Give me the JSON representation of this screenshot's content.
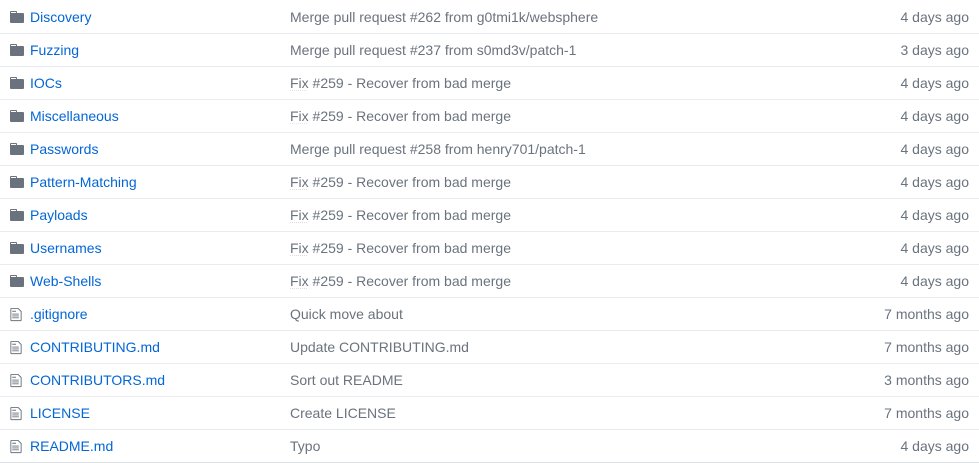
{
  "colors": {
    "link": "#0366d6",
    "muted": "#6a737d",
    "folder_icon": "#79b8ff",
    "file_icon": "#6a737d",
    "border": "#eaecef"
  },
  "rows": [
    {
      "type": "directory",
      "icon": "folder-icon",
      "name": "Discovery",
      "message_prefix": "",
      "message": "Merge pull request #262 from g0tmi1k/websphere",
      "age": "4 days ago"
    },
    {
      "type": "directory",
      "icon": "folder-icon",
      "name": "Fuzzing",
      "message_prefix": "",
      "message": "Merge pull request #237 from s0md3v/patch-1",
      "age": "3 days ago"
    },
    {
      "type": "directory",
      "icon": "folder-icon",
      "name": "IOCs",
      "message_prefix": "Fix",
      "message": " #259 - Recover from bad merge",
      "age": "4 days ago"
    },
    {
      "type": "directory",
      "icon": "folder-icon",
      "name": "Miscellaneous",
      "message_prefix": "Fix",
      "message": " #259 - Recover from bad merge",
      "age": "4 days ago"
    },
    {
      "type": "directory",
      "icon": "folder-icon",
      "name": "Passwords",
      "message_prefix": "",
      "message": "Merge pull request #258 from henry701/patch-1",
      "age": "4 days ago"
    },
    {
      "type": "directory",
      "icon": "folder-icon",
      "name": "Pattern-Matching",
      "message_prefix": "Fix",
      "message": " #259 - Recover from bad merge",
      "age": "4 days ago"
    },
    {
      "type": "directory",
      "icon": "folder-icon",
      "name": "Payloads",
      "message_prefix": "Fix",
      "message": " #259 - Recover from bad merge",
      "age": "4 days ago"
    },
    {
      "type": "directory",
      "icon": "folder-icon",
      "name": "Usernames",
      "message_prefix": "Fix",
      "message": " #259 - Recover from bad merge",
      "age": "4 days ago"
    },
    {
      "type": "directory",
      "icon": "folder-icon",
      "name": "Web-Shells",
      "message_prefix": "Fix",
      "message": " #259 - Recover from bad merge",
      "age": "4 days ago"
    },
    {
      "type": "file",
      "icon": "file-icon",
      "name": ".gitignore",
      "message_prefix": "",
      "message": "Quick move about",
      "age": "7 months ago"
    },
    {
      "type": "file",
      "icon": "file-icon",
      "name": "CONTRIBUTING.md",
      "message_prefix": "",
      "message": "Update CONTRIBUTING.md",
      "age": "7 months ago"
    },
    {
      "type": "file",
      "icon": "file-icon",
      "name": "CONTRIBUTORS.md",
      "message_prefix": "",
      "message": "Sort out README",
      "age": "3 months ago"
    },
    {
      "type": "file",
      "icon": "file-icon",
      "name": "LICENSE",
      "message_prefix": "",
      "message": "Create LICENSE",
      "age": "7 months ago"
    },
    {
      "type": "file",
      "icon": "file-icon",
      "name": "README.md",
      "message_prefix": "",
      "message": "Typo",
      "age": "4 days ago"
    }
  ]
}
